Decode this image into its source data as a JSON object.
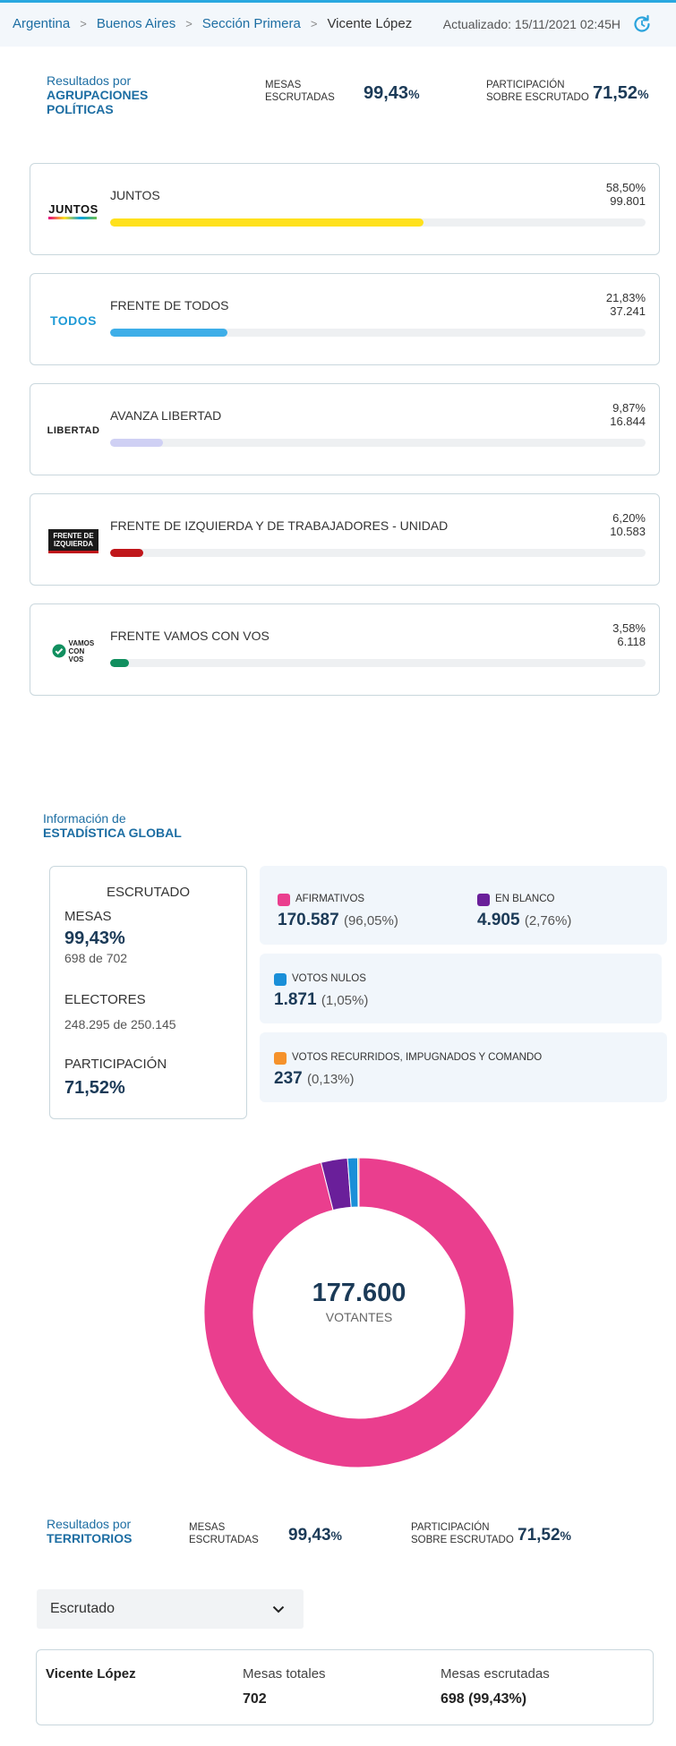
{
  "breadcrumb": {
    "items": [
      "Argentina",
      "Buenos Aires",
      "Sección Primera"
    ],
    "current": "Vicente López",
    "separator": ">"
  },
  "updated": "Actualizado: 15/11/2021 02:45H",
  "icons": {
    "refresh": "refresh-icon",
    "dropdown": "chevron-down-icon"
  },
  "summary_parties": {
    "title_top": "Resultados por",
    "title_bold": "AGRUPACIONES POLÍTICAS",
    "mesas_label_1": "MESAS",
    "mesas_label_2": "ESCRUTADAS",
    "mesas_value": "99,43",
    "part_label_1": "PARTICIPACIÓN",
    "part_label_2": "SOBRE ESCRUTADO",
    "part_value": "71,52",
    "percent_sign": "%"
  },
  "parties": [
    {
      "name": "JUNTOS",
      "pct": "58,50%",
      "votes": "99.801",
      "share": 0.585,
      "color": "#ffe11c",
      "logo_text": "JUNTOS"
    },
    {
      "name": "FRENTE DE TODOS",
      "pct": "21,83%",
      "votes": "37.241",
      "share": 0.2183,
      "color": "#3eaee8",
      "logo_text": "TODOS"
    },
    {
      "name": "AVANZA LIBERTAD",
      "pct": "9,87%",
      "votes": "16.844",
      "share": 0.0987,
      "color": "#cfd0f4",
      "logo_text": "LIBERTAD"
    },
    {
      "name": "FRENTE DE IZQUIERDA Y DE TRABAJADORES - UNIDAD",
      "pct": "6,20%",
      "votes": "10.583",
      "share": 0.062,
      "color": "#c0171b",
      "logo_text": "FRENTE DE IZQUIERDA"
    },
    {
      "name": "FRENTE VAMOS CON VOS",
      "pct": "3,58%",
      "votes": "6.118",
      "share": 0.0358,
      "color": "#118f5f",
      "logo_text": "VAMOS CON VOS"
    }
  ],
  "global_stats": {
    "title_top": "Información de",
    "title_bold": "ESTADÍSTICA GLOBAL",
    "escrutado": {
      "heading": "ESCRUTADO",
      "mesas_label": "MESAS",
      "mesas_pct": "99,43%",
      "mesas_count": "698 de 702",
      "electores_label": "ELECTORES",
      "electores_value": "248.295 de 250.145",
      "participacion_label": "PARTICIPACIÓN",
      "participacion_value": "71,52%"
    },
    "votes": [
      {
        "label": "AFIRMATIVOS",
        "value": "170.587",
        "pct": "(96,05%)",
        "color": "#ea3e8e"
      },
      {
        "label": "EN BLANCO",
        "value": "4.905",
        "pct": "(2,76%)",
        "color": "#6a1f9a"
      },
      {
        "label": "VOTOS NULOS",
        "value": "1.871",
        "pct": "(1,05%)",
        "color": "#1a8fd8"
      },
      {
        "label": "VOTOS RECURRIDOS, IMPUGNADOS Y COMANDO",
        "value": "237",
        "pct": "(0,13%)",
        "color": "#f5922b"
      }
    ],
    "total_value": "177.600",
    "total_label": "VOTANTES"
  },
  "chart_data": {
    "type": "pie",
    "categories": [
      "AFIRMATIVOS",
      "EN BLANCO",
      "VOTOS NULOS",
      "VOTOS RECURRIDOS, IMPUGNADOS Y COMANDO"
    ],
    "values": [
      170587,
      4905,
      1871,
      237
    ],
    "percentages": [
      96.05,
      2.76,
      1.05,
      0.13
    ],
    "colors": [
      "#ea3e8e",
      "#6a1f9a",
      "#1a8fd8",
      "#f5922b"
    ],
    "center_value": "177.600",
    "center_label": "VOTANTES",
    "donut": true
  },
  "summary_territories": {
    "title_top": "Resultados por",
    "title_bold": "TERRITORIOS",
    "mesas_label_1": "MESAS",
    "mesas_label_2": "ESCRUTADAS",
    "mesas_value": "99,43",
    "part_label_1": "PARTICIPACIÓN",
    "part_label_2": "SOBRE ESCRUTADO",
    "part_value": "71,52",
    "percent_sign": "%"
  },
  "territory_select": {
    "value": "Escrutado"
  },
  "territory_row": {
    "name": "Vicente López",
    "mesas_totales_label": "Mesas totales",
    "mesas_totales_value": "702",
    "mesas_escrutadas_label": "Mesas escrutadas",
    "mesas_escrutadas_value": "698 (99,43%)"
  }
}
